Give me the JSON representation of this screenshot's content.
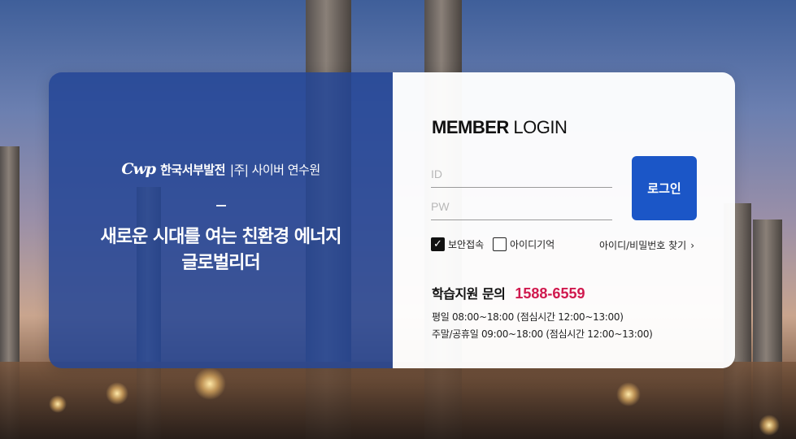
{
  "brand": {
    "logo_mark": "Cwp",
    "company": "한국서부발전",
    "suffix": "|주| 사이버 연수원"
  },
  "hero": {
    "line1": "새로운 시대를 여는 친환경 에너지",
    "line2": "글로벌리더"
  },
  "login": {
    "title_bold": "MEMBER",
    "title_rest": " LOGIN",
    "id_placeholder": "ID",
    "pw_placeholder": "PW",
    "button_label": "로그인",
    "secure_label": "보안접속",
    "secure_checked": true,
    "remember_label": "아이디기억",
    "remember_checked": false,
    "find_label": "아이디/비밀번호 찾기"
  },
  "support": {
    "label": "학습지원 문의",
    "phone": "1588-6559",
    "weekday_hours": "평일 08:00~18:00 (점심시간 12:00~13:00)",
    "weekend_hours": "주말/공휴일 09:00~18:00 (점심시간 12:00~13:00)"
  },
  "colors": {
    "panel_blue": "#2446a0",
    "button_blue": "#1b56c7",
    "phone_red": "#d0194e"
  }
}
